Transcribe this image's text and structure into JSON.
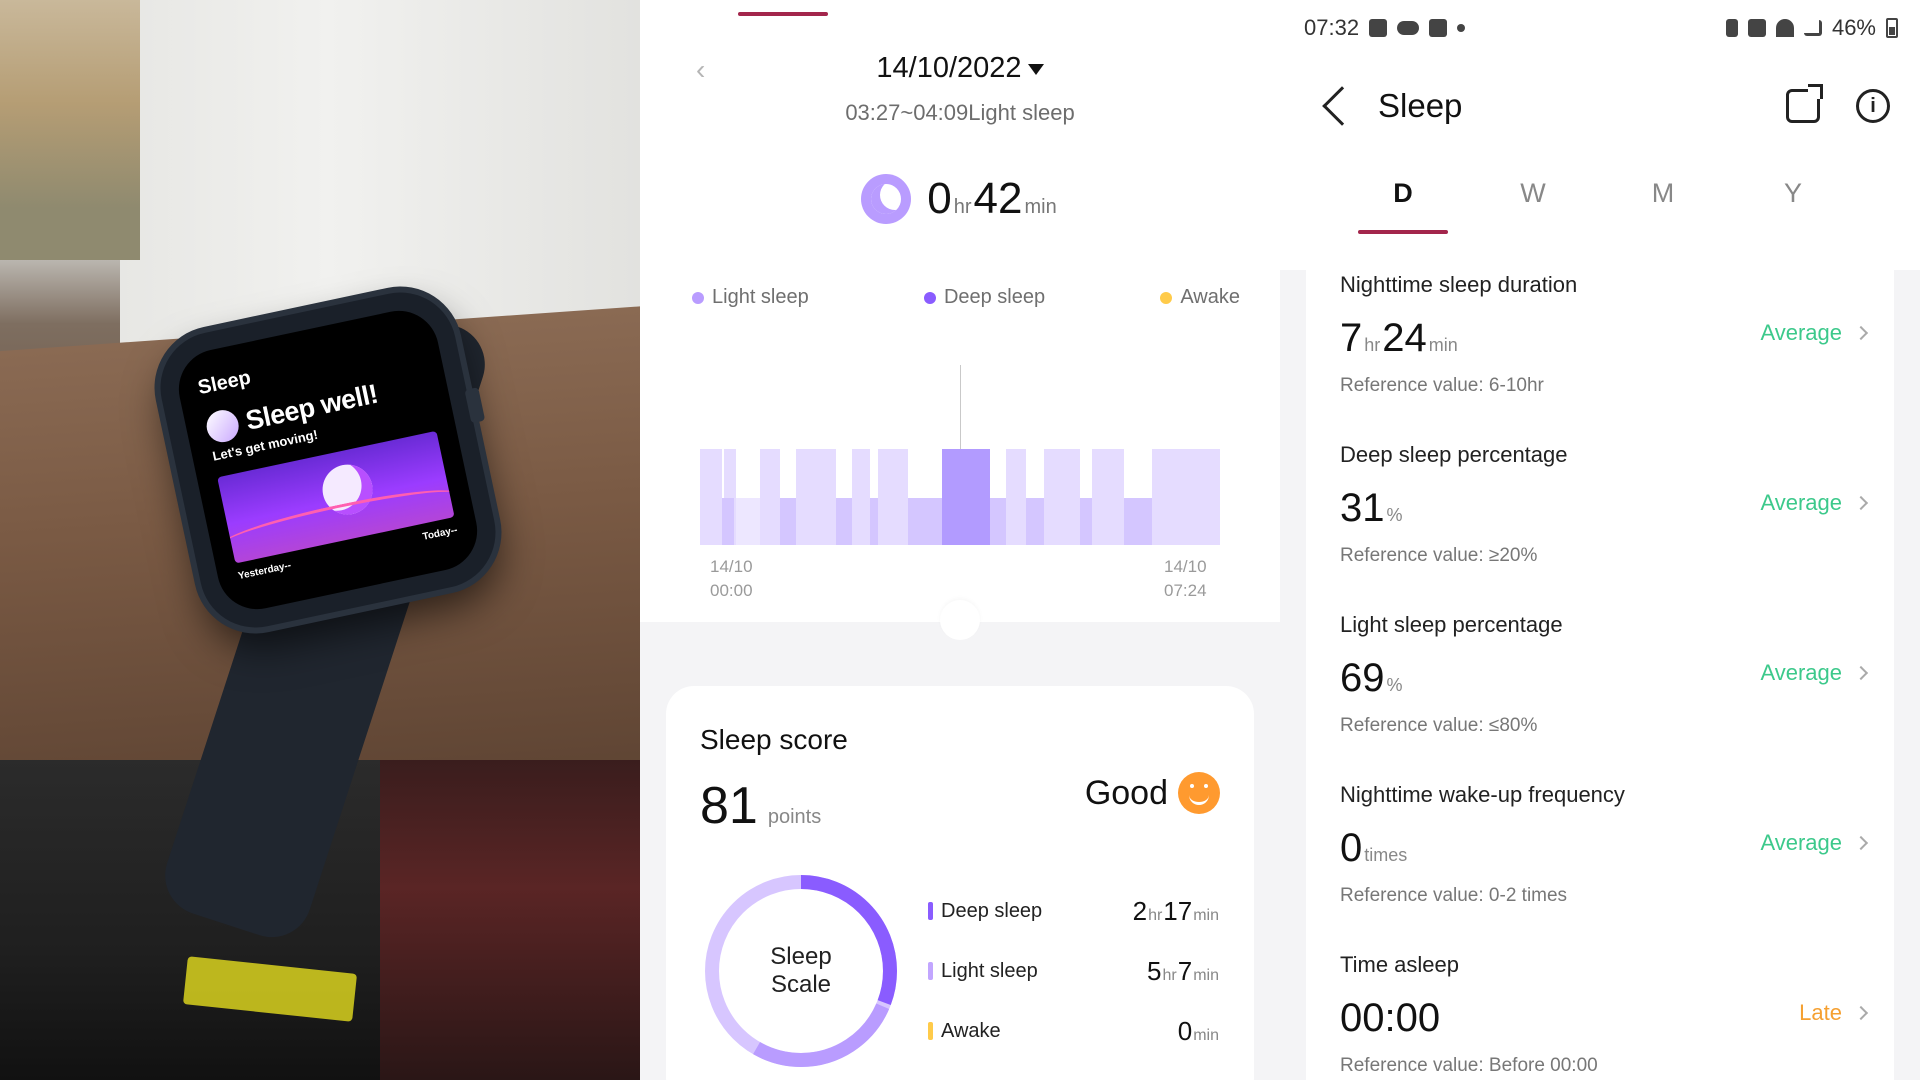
{
  "colors": {
    "light_sleep": "#e3d9ff",
    "deep_sleep": "#b29bff",
    "awake": "#ffcb4a",
    "accent_tab": "#a3264c",
    "average_green": "#3cc98b",
    "late_orange": "#f5a031",
    "smiley_orange": "#ff9a2f"
  },
  "watch": {
    "title": "Sleep",
    "headline": "Sleep well!",
    "subtitle": "Let's get moving!",
    "left_label": "Yesterday--",
    "right_label": "Today--"
  },
  "detail": {
    "date": "14/10/2022",
    "range": "03:27~04:09Light sleep",
    "duration": {
      "hours": "0",
      "hours_unit": "hr",
      "minutes": "42",
      "minutes_unit": "min"
    },
    "legend": [
      {
        "label": "Light sleep",
        "color": "#b99cff"
      },
      {
        "label": "Deep sleep",
        "color": "#8a5cff"
      },
      {
        "label": "Awake",
        "color": "#ffcb4a"
      }
    ],
    "axis": {
      "start_date": "14/10",
      "start_time": "00:00",
      "end_date": "14/10",
      "end_time": "07:24"
    }
  },
  "score": {
    "title": "Sleep score",
    "value": "81",
    "unit": "points",
    "rating": "Good",
    "donut_label_1": "Sleep",
    "donut_label_2": "Scale",
    "breakdown": [
      {
        "label": "Deep sleep",
        "value_a": "2",
        "unit_a": "hr",
        "value_b": "17",
        "unit_b": "min",
        "color": "#8a5cff"
      },
      {
        "label": "Light sleep",
        "value_a": "5",
        "unit_a": "hr",
        "value_b": "7",
        "unit_b": "min",
        "color": "#c2a6ff"
      },
      {
        "label": "Awake",
        "value_a": "",
        "unit_a": "",
        "value_b": "0",
        "unit_b": "min",
        "color": "#ffcb4a"
      }
    ]
  },
  "statusbar": {
    "time": "07:32",
    "battery": "46%"
  },
  "sleep_page": {
    "title": "Sleep",
    "tabs": [
      "D",
      "W",
      "M",
      "Y"
    ],
    "active_tab": "D",
    "metrics": [
      {
        "title": "Nighttime sleep duration",
        "value_a": "7",
        "unit_a": "hr",
        "value_b": "24",
        "unit_b": "min",
        "reference": "Reference value: 6-10hr",
        "status": "Average",
        "status_color": "#3cc98b"
      },
      {
        "title": "Deep sleep percentage",
        "value_a": "31",
        "unit_a": "%",
        "value_b": "",
        "unit_b": "",
        "reference": "Reference value: ≥20%",
        "status": "Average",
        "status_color": "#3cc98b"
      },
      {
        "title": "Light sleep percentage",
        "value_a": "69",
        "unit_a": "%",
        "value_b": "",
        "unit_b": "",
        "reference": "Reference value: ≤80%",
        "status": "Average",
        "status_color": "#3cc98b"
      },
      {
        "title": "Nighttime wake-up frequency",
        "value_a": "0",
        "unit_a": "times",
        "value_b": "",
        "unit_b": "",
        "reference": "Reference value: 0-2 times",
        "status": "Average",
        "status_color": "#3cc98b"
      },
      {
        "title": "Time asleep",
        "value_a": "00:00",
        "unit_a": "",
        "value_b": "",
        "unit_b": "",
        "reference": "Reference value: Before 00:00",
        "status": "Late",
        "status_color": "#f5a031"
      }
    ]
  }
}
